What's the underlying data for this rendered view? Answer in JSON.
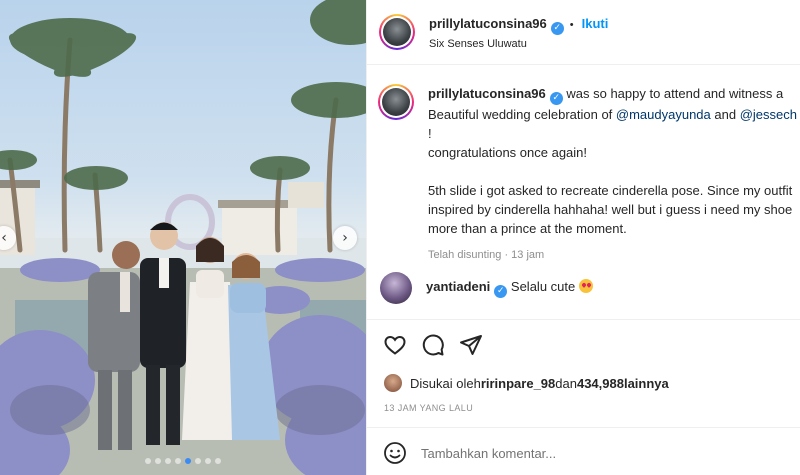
{
  "post": {
    "username": "prillylatuconsina96",
    "follow_label": "Ikuti",
    "separator": "•",
    "location": "Six Senses Uluwatu",
    "carousel_dots": 8,
    "active_dot": 4
  },
  "caption": {
    "username": "prillylatuconsina96",
    "line1": " was so happy to attend and witness a",
    "line2_pre": "Beautiful wedding celebration of ",
    "mention1": "@maudyayunda",
    "line2_mid": " and ",
    "mention2": "@jessech",
    "line3": "!",
    "line4": "congratulations once again!",
    "line5": "5th slide i got asked to recreate cinderella pose. Since my outfit",
    "line6": "inspired by cinderella hahhaha! well but i guess i need my shoe",
    "line7": "more than a prince at the moment.",
    "edited": "Telah disunting · 13 jam"
  },
  "comment": {
    "username": "yantiadeni",
    "text": " Selalu cute",
    "emoji": "heart-eyes-emoji"
  },
  "likes": {
    "prefix": "Disukai oleh ",
    "user": "ririnpare_98",
    "middle": " dan ",
    "count": "434,988",
    "suffix": " lainnya"
  },
  "time_ago": "13 JAM YANG LALU",
  "add_comment": {
    "placeholder": "Tambahkan komentar..."
  },
  "colors": {
    "link": "#0095f6",
    "mention": "#00376b",
    "verified": "#3897f0",
    "muted": "#8e8e8e"
  }
}
